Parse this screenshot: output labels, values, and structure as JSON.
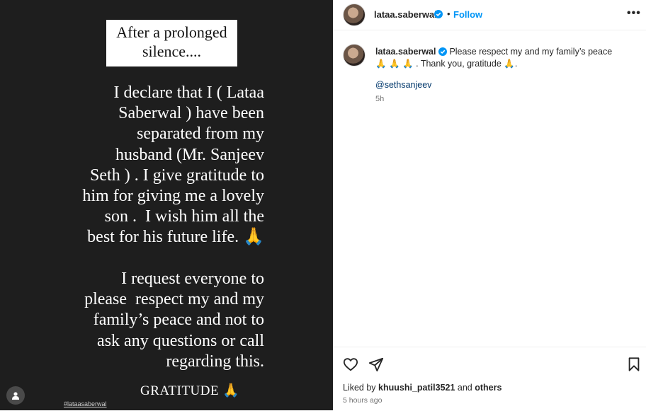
{
  "story": {
    "title": "After a prolonged\nsilence....",
    "para1": "I declare that I ( Lataa\nSaberwal ) have been\nseparated from my\nhusband (Mr. Sanjeev\nSeth ) . I give gratitude to\nhim for giving me a lovely\nson .  I wish him all the\nbest for his future life. 🙏",
    "para2": "I request everyone to\nplease  respect my and my\nfamily’s peace and not to\nask any questions or call\nregarding this.",
    "gratitude": "GRATITUDE 🙏",
    "hashtag": "#lataasaberwal"
  },
  "header": {
    "username": "lataa.saberwal",
    "dot": "•",
    "follow_label": "Follow",
    "more_label": "•••"
  },
  "caption": {
    "username": "lataa.saberwal",
    "text": "Please respect my and my family’s peace 🙏 🙏 🙏 . Thank you, gratitude 🙏.",
    "mention": "@sethsanjeev",
    "age": "5h"
  },
  "footer": {
    "liked_prefix": "Liked by",
    "liked_user": "khuushi_patil3521",
    "liked_and": "and",
    "liked_others": "others",
    "time": "5 hours ago"
  },
  "colors": {
    "accent": "#0095f6",
    "verified": "#0095f6",
    "media_bg": "#1e1e1e"
  }
}
